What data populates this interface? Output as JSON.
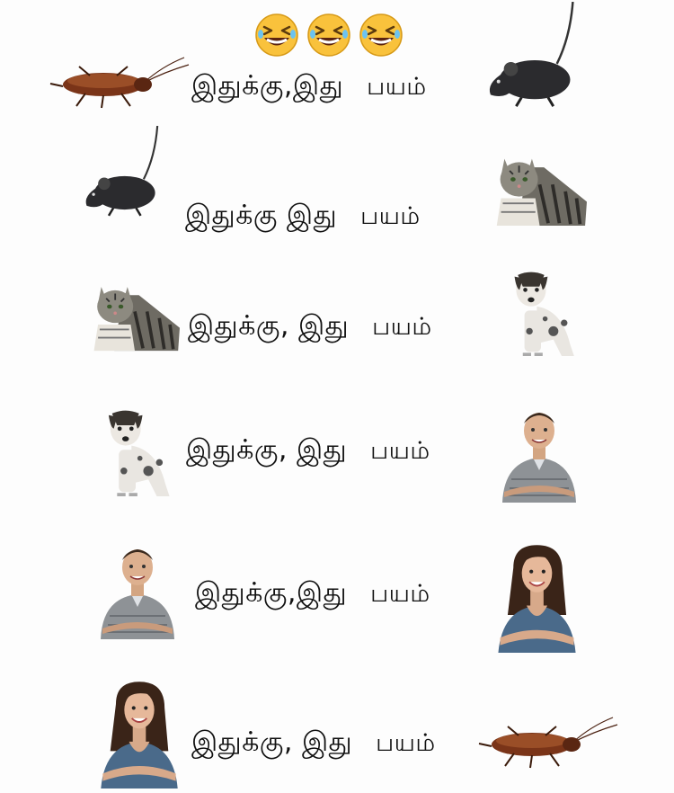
{
  "header": {
    "emoji_name": "rolling-on-floor-laughing-face",
    "emoji_count": 3
  },
  "rows": [
    {
      "left_picture": "cockroach",
      "text_this": "இதுக்கு,இது",
      "text_fear": "பயம்",
      "right_picture": "rat"
    },
    {
      "left_picture": "rat",
      "text_this": "இதுக்கு இது",
      "text_fear": "பயம்",
      "right_picture": "cat"
    },
    {
      "left_picture": "cat",
      "text_this": "இதுக்கு, இது",
      "text_fear": "பயம்",
      "right_picture": "dog"
    },
    {
      "left_picture": "dog",
      "text_this": "இதுக்கு, இது",
      "text_fear": "பயம்",
      "right_picture": "man"
    },
    {
      "left_picture": "man",
      "text_this": "இதுக்கு,இது",
      "text_fear": "பயம்",
      "right_picture": "woman"
    },
    {
      "left_picture": "woman",
      "text_this": "இதுக்கு, இது",
      "text_fear": "பயம்",
      "right_picture": "cockroach"
    }
  ],
  "colors": {
    "background": "#fdfdfd",
    "text": "#111111",
    "emoji_face": "#f9c23c",
    "cockroach": "#7a3418",
    "rat": "#2b2b2e",
    "cat_fur": "#8d8a80",
    "dog_fur": "#e9e6e1",
    "man_shirt": "#8e9296",
    "woman_top": "#4a6a8a"
  }
}
